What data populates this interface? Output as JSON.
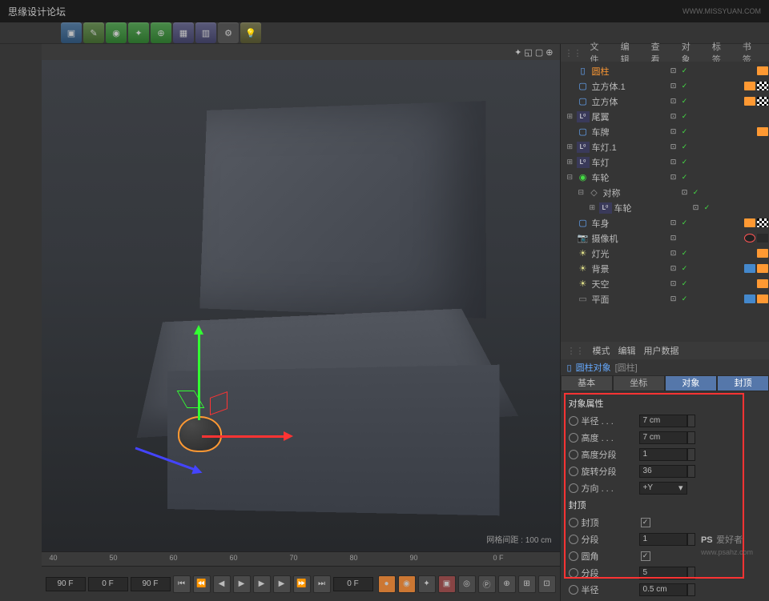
{
  "header": {
    "left": "思缘设计论坛",
    "right": "WWW.MISSYUAN.COM"
  },
  "vp": {
    "opts": "✦ ◱ ▢ ⊕",
    "info": "网格间距 : 100 cm"
  },
  "ruler": {
    "ticks": [
      "40",
      "50",
      "60",
      "60",
      "70",
      "80",
      "90"
    ],
    "end": "0 F"
  },
  "timeline": {
    "f1": "90 F",
    "f2": "0 F",
    "f3": "90 F",
    "f4": "0 F"
  },
  "om": {
    "tabs": [
      "文件",
      "编辑",
      "查看",
      "对象",
      "标签",
      "书签"
    ],
    "items": [
      {
        "indent": 0,
        "exp": "",
        "ico": "cyl",
        "name": "圆柱",
        "sel": true,
        "chk": true,
        "tags": [
          "or"
        ]
      },
      {
        "indent": 0,
        "exp": "",
        "ico": "cube",
        "name": "立方体.1",
        "chk": true,
        "tags": [
          "or",
          "ck"
        ]
      },
      {
        "indent": 0,
        "exp": "",
        "ico": "cube",
        "name": "立方体",
        "chk": true,
        "tags": [
          "or",
          "ck"
        ]
      },
      {
        "indent": 0,
        "exp": "⊞",
        "ico": "L",
        "name": "尾翼",
        "chk": true,
        "tags": []
      },
      {
        "indent": 0,
        "exp": "",
        "ico": "cube",
        "name": "车牌",
        "chk": true,
        "tags": [
          "or"
        ]
      },
      {
        "indent": 0,
        "exp": "⊞",
        "ico": "L",
        "name": "车灯.1",
        "chk": true,
        "tags": []
      },
      {
        "indent": 0,
        "exp": "⊞",
        "ico": "L",
        "name": "车灯",
        "chk": true,
        "tags": []
      },
      {
        "indent": 0,
        "exp": "⊟",
        "ico": "w",
        "name": "车轮",
        "chk": true,
        "tags": []
      },
      {
        "indent": 1,
        "exp": "⊟",
        "ico": "sym",
        "name": "对称",
        "chk": true,
        "tags": []
      },
      {
        "indent": 2,
        "exp": "⊞",
        "ico": "L",
        "name": "车轮",
        "chk": true,
        "tags": []
      },
      {
        "indent": 0,
        "exp": "",
        "ico": "cube",
        "name": "车身",
        "chk": true,
        "tags": [
          "or",
          "ck"
        ]
      },
      {
        "indent": 0,
        "exp": "",
        "ico": "cam",
        "name": "摄像机",
        "chk": false,
        "no": true,
        "tags": [
          "dk"
        ]
      },
      {
        "indent": 0,
        "exp": "",
        "ico": "lt",
        "name": "灯光",
        "chk": true,
        "tags": [
          "or"
        ]
      },
      {
        "indent": 0,
        "exp": "",
        "ico": "lt",
        "name": "背景",
        "chk": true,
        "tags": [
          "bl",
          "or"
        ]
      },
      {
        "indent": 0,
        "exp": "",
        "ico": "lt",
        "name": "天空",
        "chk": true,
        "tags": [
          "or"
        ]
      },
      {
        "indent": 0,
        "exp": "",
        "ico": "pl",
        "name": "平面",
        "chk": true,
        "tags": [
          "bl",
          "or"
        ]
      }
    ]
  },
  "attr": {
    "hdr": [
      "模式",
      "编辑",
      "用户数据"
    ],
    "title": {
      "obj": "圆柱对象",
      "hint": "[圆柱]"
    },
    "tabs": [
      "基本",
      "坐标",
      "对象",
      "封顶"
    ],
    "sec1": "对象属性",
    "props1": [
      {
        "lbl": "半径 . . .",
        "val": "7 cm",
        "spin": true
      },
      {
        "lbl": "高度 . . .",
        "val": "7 cm",
        "spin": true
      },
      {
        "lbl": "高度分段",
        "val": "1",
        "spin": true
      },
      {
        "lbl": "旋转分段",
        "val": "36",
        "spin": true
      },
      {
        "lbl": "方向 . . .",
        "dd": "+Y"
      }
    ],
    "sec2": "封顶",
    "props2": [
      {
        "lbl": "封顶",
        "cb": true
      },
      {
        "lbl": "分段",
        "val": "1",
        "spin": true
      },
      {
        "lbl": "圆角",
        "cb": true
      },
      {
        "lbl": "分段",
        "val": "5",
        "spin": true
      },
      {
        "lbl": "半径",
        "val": "0.5 cm",
        "spin": true
      }
    ]
  },
  "footer": {
    "brand": "PS",
    "sub": "爱好者",
    "url": "www.psahz.com"
  }
}
